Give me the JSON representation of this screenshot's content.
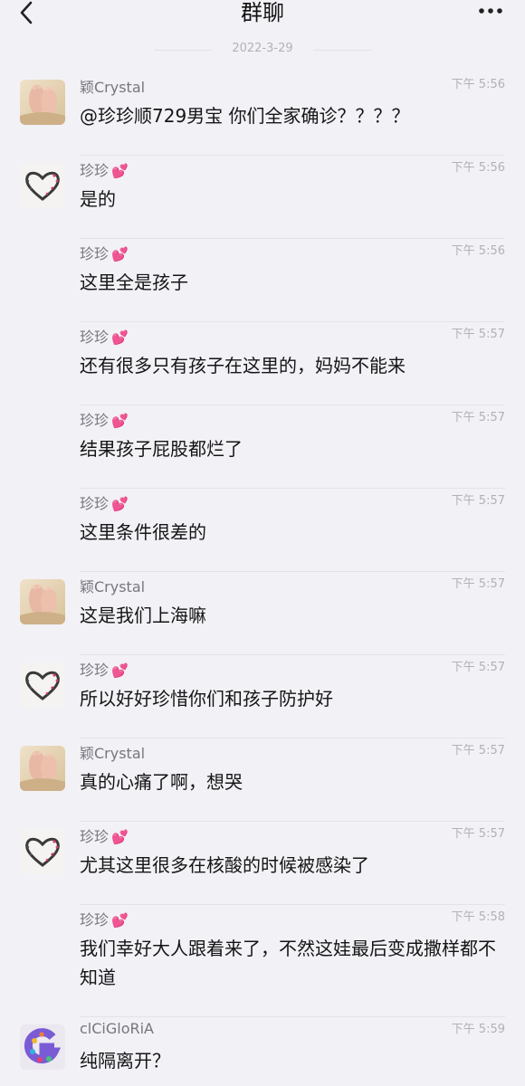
{
  "header": {
    "title": "群聊",
    "back_icon": "chevron-left-icon",
    "more_icon": "more-dots-icon"
  },
  "date_separator": "2022-3-29",
  "messages": [
    {
      "sender": "颖Crystal",
      "time": "下午 5:56",
      "text": "@珍珍顺729男宝 你们全家确诊？？？？",
      "avatar": "feet-photo",
      "heart": false
    },
    {
      "sender": "珍珍",
      "time": "下午 5:56",
      "text": "是的",
      "avatar": "heart-drawing",
      "heart": true
    },
    {
      "sender": "珍珍",
      "time": "下午 5:56",
      "text": "这里全是孩子",
      "avatar": "",
      "heart": true
    },
    {
      "sender": "珍珍",
      "time": "下午 5:57",
      "text": "还有很多只有孩子在这里的，妈妈不能来",
      "avatar": "",
      "heart": true
    },
    {
      "sender": "珍珍",
      "time": "下午 5:57",
      "text": "结果孩子屁股都烂了",
      "avatar": "",
      "heart": true
    },
    {
      "sender": "珍珍",
      "time": "下午 5:57",
      "text": "这里条件很差的",
      "avatar": "",
      "heart": true
    },
    {
      "sender": "颖Crystal",
      "time": "下午 5:57",
      "text": "这是我们上海嘛",
      "avatar": "feet-photo",
      "heart": false
    },
    {
      "sender": "珍珍",
      "time": "下午 5:57",
      "text": "所以好好珍惜你们和孩子防护好",
      "avatar": "heart-drawing",
      "heart": true
    },
    {
      "sender": "颖Crystal",
      "time": "下午 5:57",
      "text": "真的心痛了啊，想哭",
      "avatar": "feet-photo",
      "heart": false
    },
    {
      "sender": "珍珍",
      "time": "下午 5:57",
      "text": "尤其这里很多在核酸的时候被感染了",
      "avatar": "heart-drawing",
      "heart": true
    },
    {
      "sender": "珍珍",
      "time": "下午 5:58",
      "text": "我们幸好大人跟着来了，不然这娃最后变成撒样都不知道",
      "avatar": "",
      "heart": true
    },
    {
      "sender": "clCiGloRiA",
      "time": "下午 5:59",
      "text": "纯隔离开？",
      "avatar": "letter-g-colorful",
      "heart": false
    }
  ],
  "colors": {
    "background": "#f2f1f6",
    "heart": "#ff4fa0"
  }
}
